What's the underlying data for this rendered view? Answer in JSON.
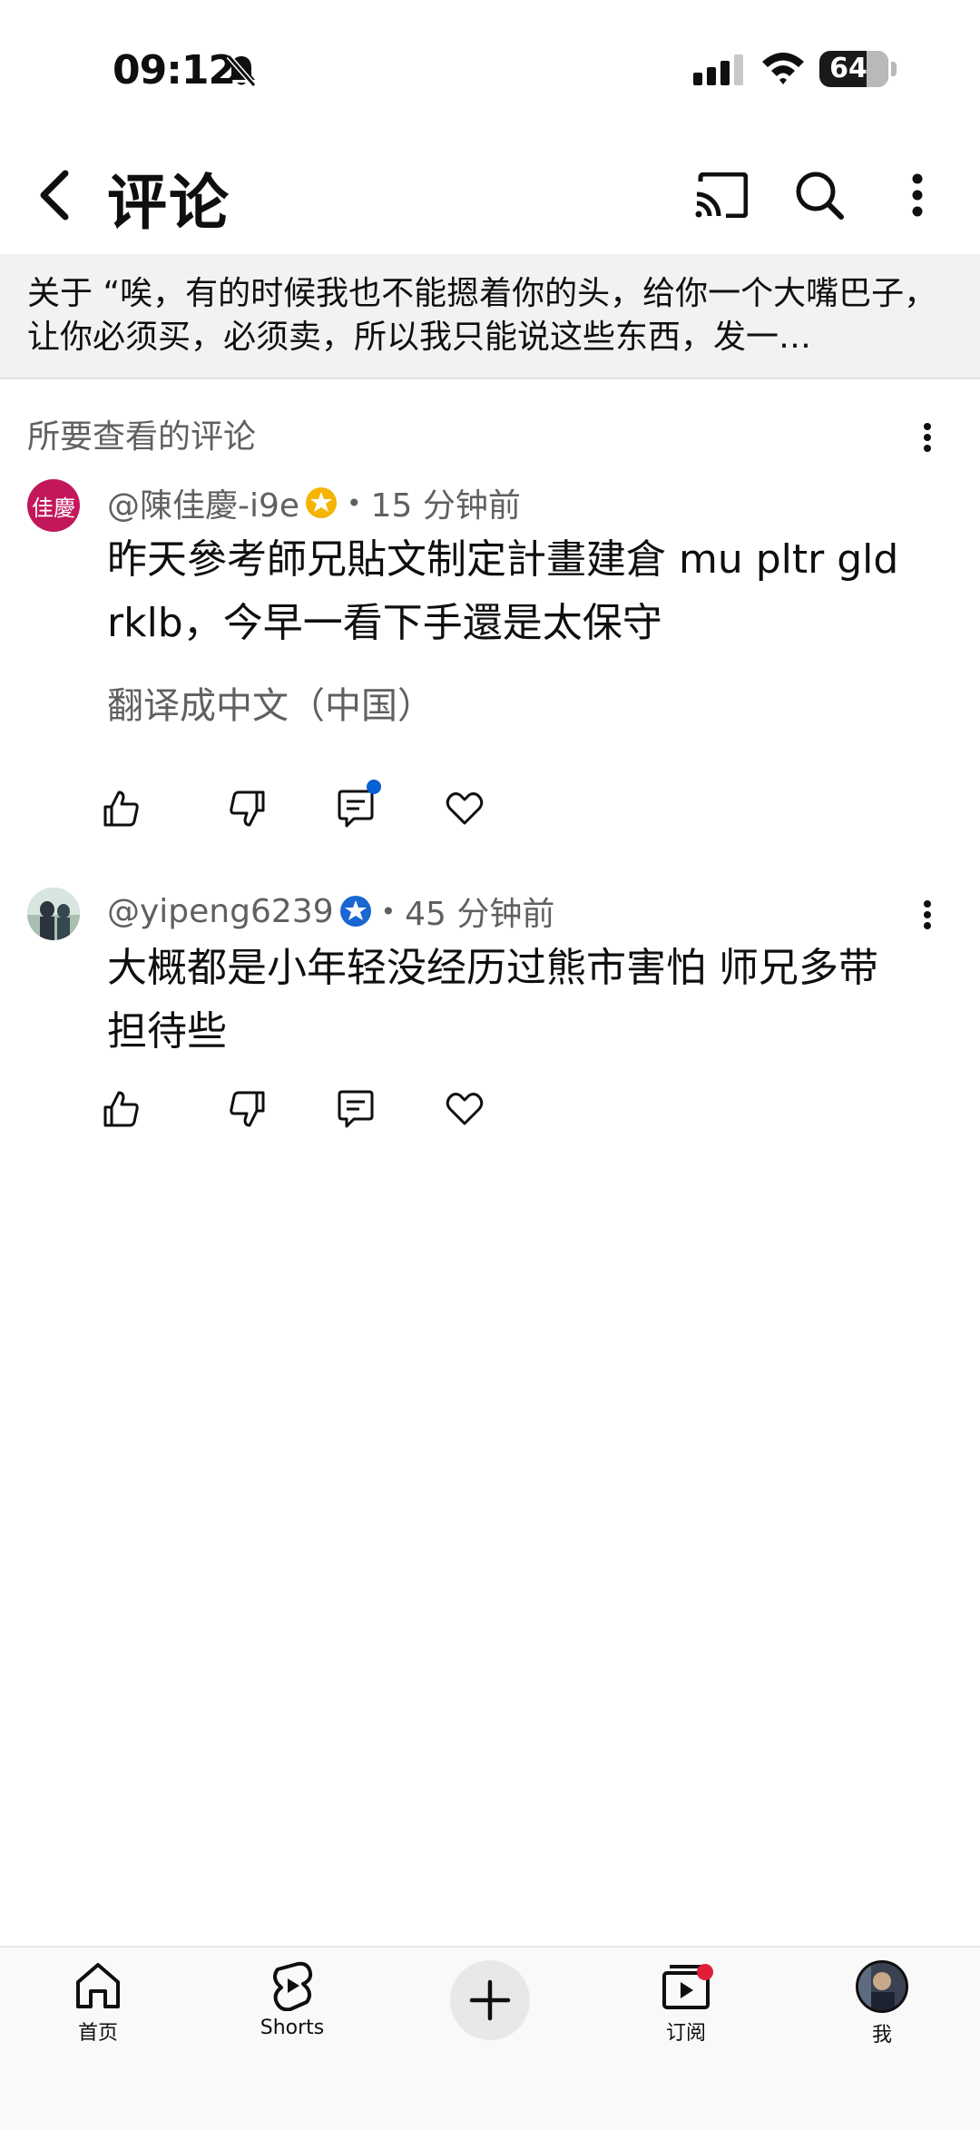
{
  "status_bar": {
    "time": "09:12",
    "battery": "64"
  },
  "header": {
    "title": "评论"
  },
  "video_context": {
    "text": "关于 “唉，有的时候我也不能摁着你的头，给你一个大嘴巴子，让你必须买，必须卖，所以我只能说这些东西，发一…"
  },
  "section": {
    "title": "所要查看的评论"
  },
  "comments": [
    {
      "avatar_text": "佳慶",
      "author": "@陳佳慶-i9e",
      "badge_color": "#f4b400",
      "time": "15 分钟前",
      "text": "昨天參考師兄貼文制定計畫建倉 mu pltr gld rklb，今早一看下手還是太保守",
      "translate_label": "翻译成中文（中国）"
    },
    {
      "author": "@yipeng6239",
      "badge_color": "#1a66d2",
      "time": "45 分钟前",
      "text": "大概都是小年轻没经历过熊市害怕 师兄多带担待些"
    }
  ],
  "bottom_nav": {
    "home": "首页",
    "shorts": "Shorts",
    "subscriptions": "订阅",
    "me": "我"
  }
}
